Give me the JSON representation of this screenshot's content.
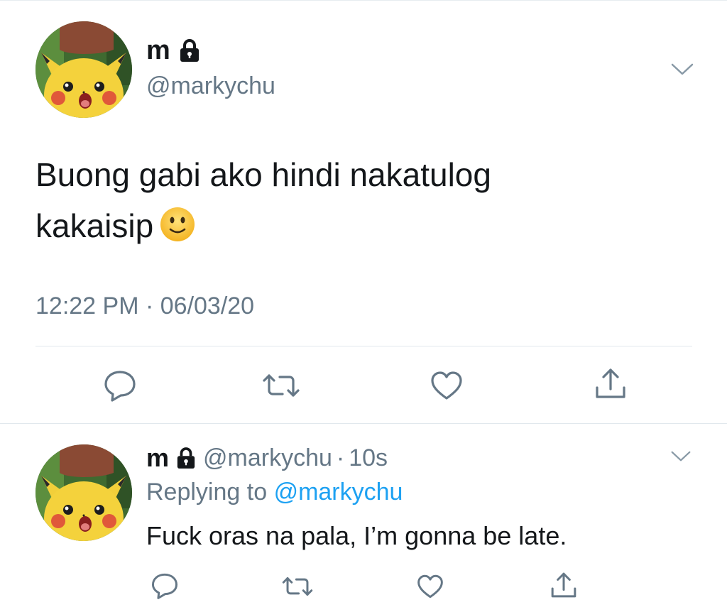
{
  "main_tweet": {
    "name": "m",
    "handle": "@markychu",
    "text_line1": "Buong gabi ako hindi nakatulog",
    "text_line2": "kakaisip",
    "emoji": "slightly-smiling-face-icon",
    "timestamp": "12:22 PM · 06/03/20",
    "avatar": "pikachu-avatar",
    "locked": true,
    "actions": [
      "reply-icon",
      "retweet-icon",
      "like-icon",
      "share-icon"
    ]
  },
  "reply_tweet": {
    "name": "m",
    "handle": "@markychu",
    "separator": "·",
    "time_ago": "10s",
    "replying_prefix": "Replying to",
    "replying_mention": "@markychu",
    "text": "Fuck oras na pala, I’m gonna be late.",
    "avatar": "pikachu-avatar",
    "locked": true,
    "actions": [
      "reply-icon",
      "retweet-icon",
      "like-icon",
      "share-icon"
    ]
  },
  "colors": {
    "text": "#14171a",
    "secondary": "#657786",
    "link": "#1da1f2",
    "icon": "#657786",
    "divider": "#e1e8ed"
  }
}
